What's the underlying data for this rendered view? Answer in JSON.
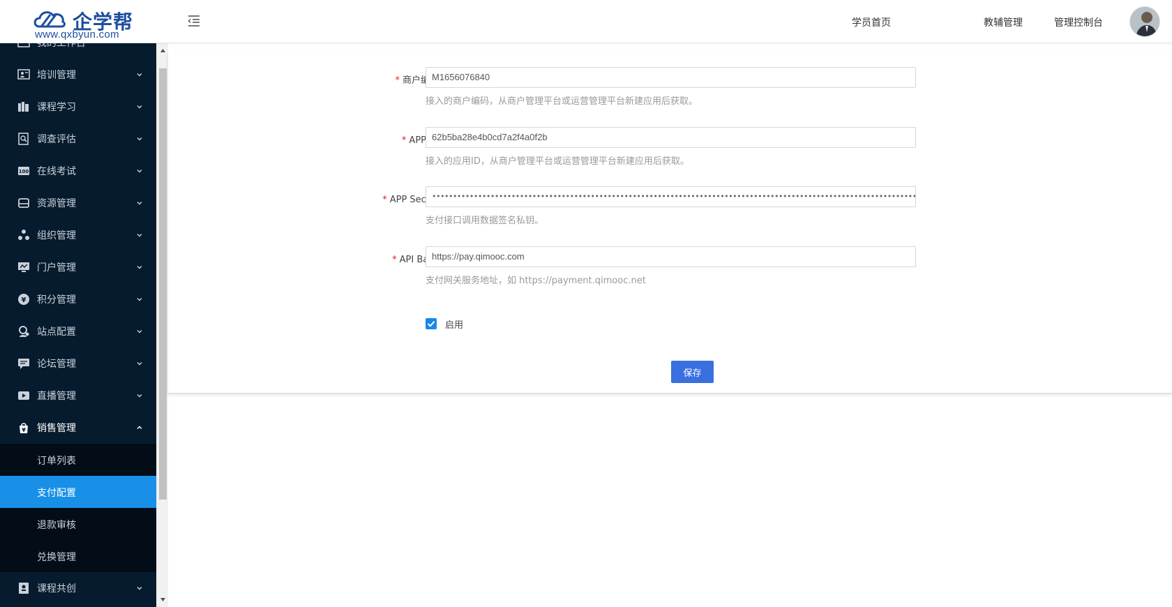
{
  "brand": {
    "name": "企学帮",
    "url": "www.qxbyun.com"
  },
  "header": {
    "nav": [
      {
        "label": "学员首页"
      },
      {
        "label": "教辅管理"
      },
      {
        "label": "管理控制台"
      }
    ]
  },
  "sidebar": {
    "partial_top_label": "我的工作台",
    "items": [
      {
        "label": "培训管理",
        "icon": "training-icon"
      },
      {
        "label": "课程学习",
        "icon": "books-icon"
      },
      {
        "label": "调查评估",
        "icon": "survey-icon"
      },
      {
        "label": "在线考试",
        "icon": "exam-100-icon"
      },
      {
        "label": "资源管理",
        "icon": "resource-icon"
      },
      {
        "label": "组织管理",
        "icon": "org-icon"
      },
      {
        "label": "门户管理",
        "icon": "portal-icon"
      },
      {
        "label": "积分管理",
        "icon": "yen-coin-icon"
      },
      {
        "label": "站点配置",
        "icon": "site-config-icon"
      },
      {
        "label": "论坛管理",
        "icon": "forum-icon"
      },
      {
        "label": "直播管理",
        "icon": "live-icon"
      },
      {
        "label": "销售管理",
        "icon": "sales-bag-icon",
        "expanded": true
      }
    ],
    "sub_items": [
      {
        "label": "订单列表"
      },
      {
        "label": "支付配置",
        "selected": true
      },
      {
        "label": "退款审核"
      },
      {
        "label": "兑换管理"
      }
    ],
    "bottom_item": {
      "label": "课程共创",
      "icon": "co-create-icon"
    }
  },
  "form": {
    "merchant_code": {
      "label": "商户编码",
      "value": "M1656076840",
      "help": "接入的商户编码，从商户管理平台或运营管理平台新建应用后获取。"
    },
    "app_id": {
      "label": "APP ID",
      "value": "62b5ba28e4b0cd7a2f4a0f2b",
      "help": "接入的应用ID，从商户管理平台或运营管理平台新建应用后获取。"
    },
    "app_secret": {
      "label": "APP Secret",
      "value": "••••••••••••••••••••••••••••••••••••••••••••••••••••••••••••••••••••••••••••••••••••••••••••••••••••••••••••••••••••••••••••••••••••••••",
      "help": "支付接口调用数据签名私钥。"
    },
    "api_base": {
      "label": "API Base",
      "value": "https://pay.qimooc.com",
      "help": "支付网关服务地址，如 https://payment.qimooc.net"
    },
    "enabled": {
      "label": "启用",
      "checked": true
    },
    "label_suffix": "：",
    "save_label": "保存"
  },
  "colors": {
    "sidebar_bg": "#071b2e",
    "submenu_bg": "#020d18",
    "selected_bg": "#1890e8",
    "primary_button": "#3a6fe0",
    "required": "#e02020"
  }
}
